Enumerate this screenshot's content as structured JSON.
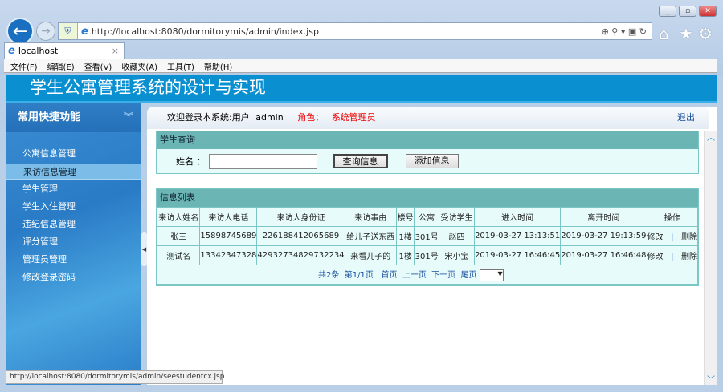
{
  "browser": {
    "url": "http://localhost:8080/dormitorymis/admin/index.jsp",
    "tab_title": "localhost",
    "menu": [
      "文件(F)",
      "编辑(E)",
      "查看(V)",
      "收藏夹(A)",
      "工具(T)",
      "帮助(H)"
    ],
    "status_url": "http://localhost:8080/dormitorymis/admin/seestudentcx.jsp"
  },
  "app": {
    "title": "学生公寓管理系统的设计与实现"
  },
  "sidebar": {
    "title": "常用快捷功能",
    "items": [
      "公寓信息管理",
      "来访信息管理",
      "学生管理",
      "学生入住管理",
      "违纪信息管理",
      "评分管理",
      "管理员管理",
      "修改登录密码"
    ]
  },
  "topbar": {
    "welcome": "欢迎登录本系统:用户",
    "user": "admin",
    "role_label": "角色：",
    "role": "系统管理员",
    "logout": "退出"
  },
  "search": {
    "title": "学生查询",
    "name_label": "姓名 ：",
    "name_value": "",
    "query_button": "查询信息",
    "add_button": "添加信息"
  },
  "list": {
    "title": "信息列表",
    "columns": [
      "来访人姓名",
      "来访人电话",
      "来访人身份证",
      "来访事由",
      "楼号",
      "公寓",
      "受访学生",
      "进入时间",
      "离开时间",
      "操作"
    ],
    "rows": [
      [
        "张三",
        "15898745689",
        "226188412065689",
        "给儿子送东西",
        "1楼",
        "301号",
        "赵四",
        "2019-03-27 13:13:51",
        "2019-03-27 19:13:59"
      ],
      [
        "测试名",
        "13342347328",
        "42932734829732234",
        "来看儿子的",
        "1楼",
        "301号",
        "宋小宝",
        "2019-03-27 16:46:45",
        "2019-03-27 16:46:48"
      ]
    ],
    "edit": "修改",
    "sep": "|",
    "delete": "删除",
    "pagination": {
      "total": "共2条",
      "page": "第1/1页",
      "first": "首页",
      "prev": "上一页",
      "next": "下一页",
      "last": "尾页"
    }
  }
}
